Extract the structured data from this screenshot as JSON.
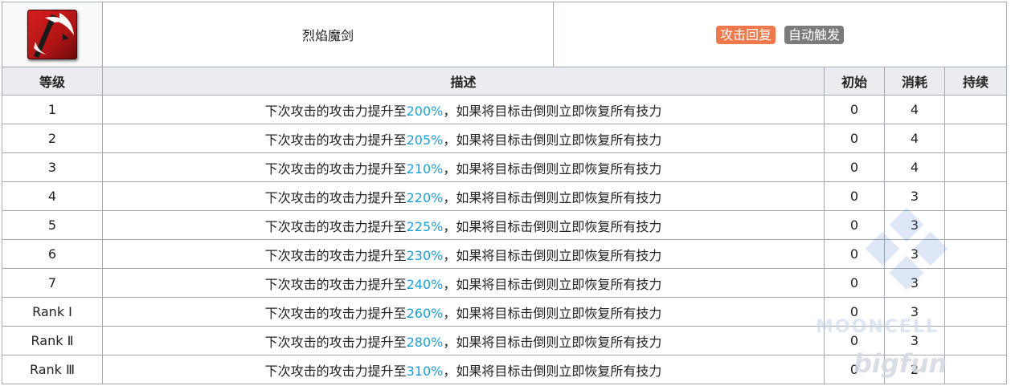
{
  "skill": {
    "icon": "flame-sword-skill-icon",
    "name": "烈焰魔剑",
    "tags": [
      {
        "label": "攻击回复",
        "color": "#f0784d"
      },
      {
        "label": "自动触发",
        "color": "#7b7b7b"
      }
    ]
  },
  "columns": {
    "level": "等级",
    "description": "描述",
    "initial": "初始",
    "cost": "消耗",
    "duration": "持续"
  },
  "rows": [
    {
      "level": "1",
      "desc_pre": "下次攻击的攻击力提升至",
      "pct": "200%",
      "desc_post": "，如果将目标击倒则立即恢复所有技力",
      "initial": "0",
      "cost": "4",
      "duration": ""
    },
    {
      "level": "2",
      "desc_pre": "下次攻击的攻击力提升至",
      "pct": "205%",
      "desc_post": "，如果将目标击倒则立即恢复所有技力",
      "initial": "0",
      "cost": "4",
      "duration": ""
    },
    {
      "level": "3",
      "desc_pre": "下次攻击的攻击力提升至",
      "pct": "210%",
      "desc_post": "，如果将目标击倒则立即恢复所有技力",
      "initial": "0",
      "cost": "4",
      "duration": ""
    },
    {
      "level": "4",
      "desc_pre": "下次攻击的攻击力提升至",
      "pct": "220%",
      "desc_post": "，如果将目标击倒则立即恢复所有技力",
      "initial": "0",
      "cost": "3",
      "duration": ""
    },
    {
      "level": "5",
      "desc_pre": "下次攻击的攻击力提升至",
      "pct": "225%",
      "desc_post": "，如果将目标击倒则立即恢复所有技力",
      "initial": "0",
      "cost": "3",
      "duration": ""
    },
    {
      "level": "6",
      "desc_pre": "下次攻击的攻击力提升至",
      "pct": "230%",
      "desc_post": "，如果将目标击倒则立即恢复所有技力",
      "initial": "0",
      "cost": "3",
      "duration": ""
    },
    {
      "level": "7",
      "desc_pre": "下次攻击的攻击力提升至",
      "pct": "240%",
      "desc_post": "，如果将目标击倒则立即恢复所有技力",
      "initial": "0",
      "cost": "3",
      "duration": ""
    },
    {
      "level": "Rank Ⅰ",
      "desc_pre": "下次攻击的攻击力提升至",
      "pct": "260%",
      "desc_post": "，如果将目标击倒则立即恢复所有技力",
      "initial": "0",
      "cost": "3",
      "duration": ""
    },
    {
      "level": "Rank Ⅱ",
      "desc_pre": "下次攻击的攻击力提升至",
      "pct": "280%",
      "desc_post": "，如果将目标击倒则立即恢复所有技力",
      "initial": "0",
      "cost": "3",
      "duration": ""
    },
    {
      "level": "Rank Ⅲ",
      "desc_pre": "下次攻击的攻击力提升至",
      "pct": "310%",
      "desc_post": "，如果将目标击倒则立即恢复所有技力",
      "initial": "0",
      "cost": "2",
      "duration": ""
    }
  ],
  "colors": {
    "percent": "#1a9fd9",
    "header_bg": "#eaecf0",
    "border": "#a2a9b1"
  },
  "watermarks": {
    "site": "MOONCELL",
    "brand": "bigfun"
  }
}
